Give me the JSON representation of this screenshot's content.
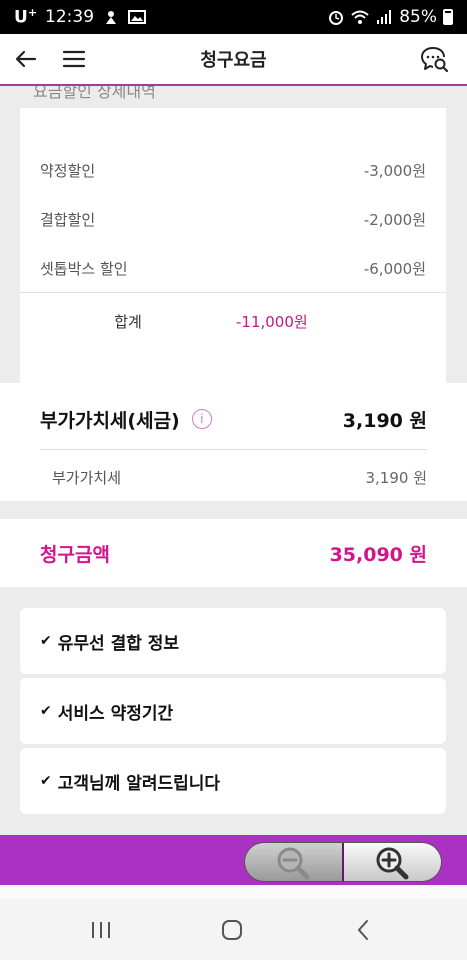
{
  "status_bar": {
    "carrier": "U",
    "carrier_sup": "+",
    "time": "12:39",
    "battery": "85%",
    "icons": [
      "notification-icon",
      "image-icon",
      "alarm-icon",
      "wifi-icon",
      "signal-icon",
      "battery-icon"
    ]
  },
  "header": {
    "title": "청구요금",
    "icons": [
      "back-arrow-icon",
      "hamburger-menu-icon",
      "chat-search-icon"
    ]
  },
  "discount": {
    "section_title": "요금할인 상세내역",
    "items": [
      {
        "label": "약정할인",
        "amount": "-3,000원"
      },
      {
        "label": "결합할인",
        "amount": "-2,000원"
      },
      {
        "label": "셋톱박스 할인",
        "amount": "-6,000원"
      }
    ],
    "total_label": "합계",
    "total_amount": "-11,000원"
  },
  "vat": {
    "label": "부가가치세(세금)",
    "info_icon": "i",
    "total": "3,190 원",
    "sub_label": "부가가치세",
    "sub_amount": "3,190 원"
  },
  "billing": {
    "label": "청구금액",
    "amount": "35,090 원"
  },
  "accordions": [
    {
      "label": "유무선 결합 정보"
    },
    {
      "label": "서비스 약정기간"
    },
    {
      "label": "고객님께 알려드립니다"
    }
  ],
  "check_glyph": "✔",
  "colors": {
    "accent": "#d4148c",
    "zoom_bar": "#a932c2",
    "header_border": "#a53aa5"
  }
}
